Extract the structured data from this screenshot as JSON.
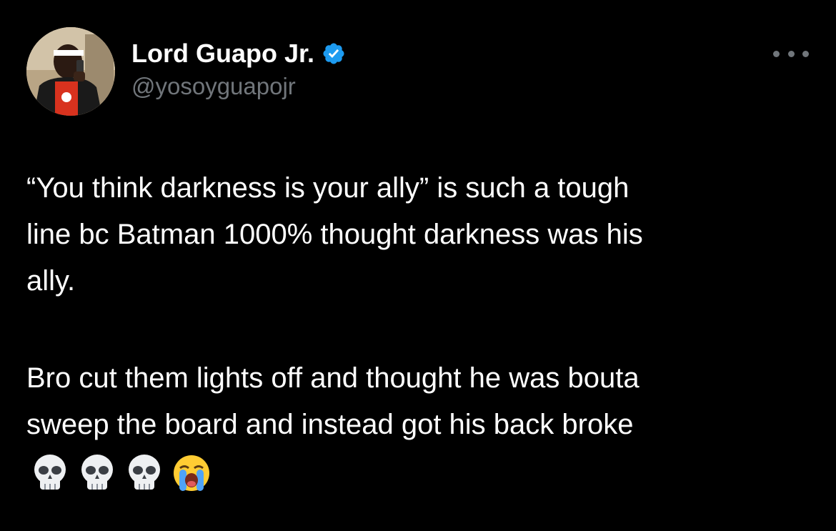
{
  "author": {
    "display_name": "Lord Guapo Jr.",
    "handle": "@yosoyguapojr",
    "verified_icon": "verified-badge-icon",
    "verified_color": "#1d9bf0",
    "avatar": "profile-photo-avatar"
  },
  "menu": {
    "icon": "more-options-icon"
  },
  "tweet": {
    "paragraph1": [
      "“You think darkness is your ally” is such a tough",
      "line bc Batman 1000% thought darkness was his",
      "ally."
    ],
    "paragraph2": [
      "Bro cut them lights off and thought he was bouta",
      "sweep the board and instead got his back broke"
    ],
    "emojis": [
      "skull",
      "skull",
      "skull",
      "loudly-crying-face"
    ]
  },
  "colors": {
    "background": "#000000",
    "text": "#ffffff",
    "secondary_text": "#71767b",
    "accent": "#1d9bf0"
  }
}
